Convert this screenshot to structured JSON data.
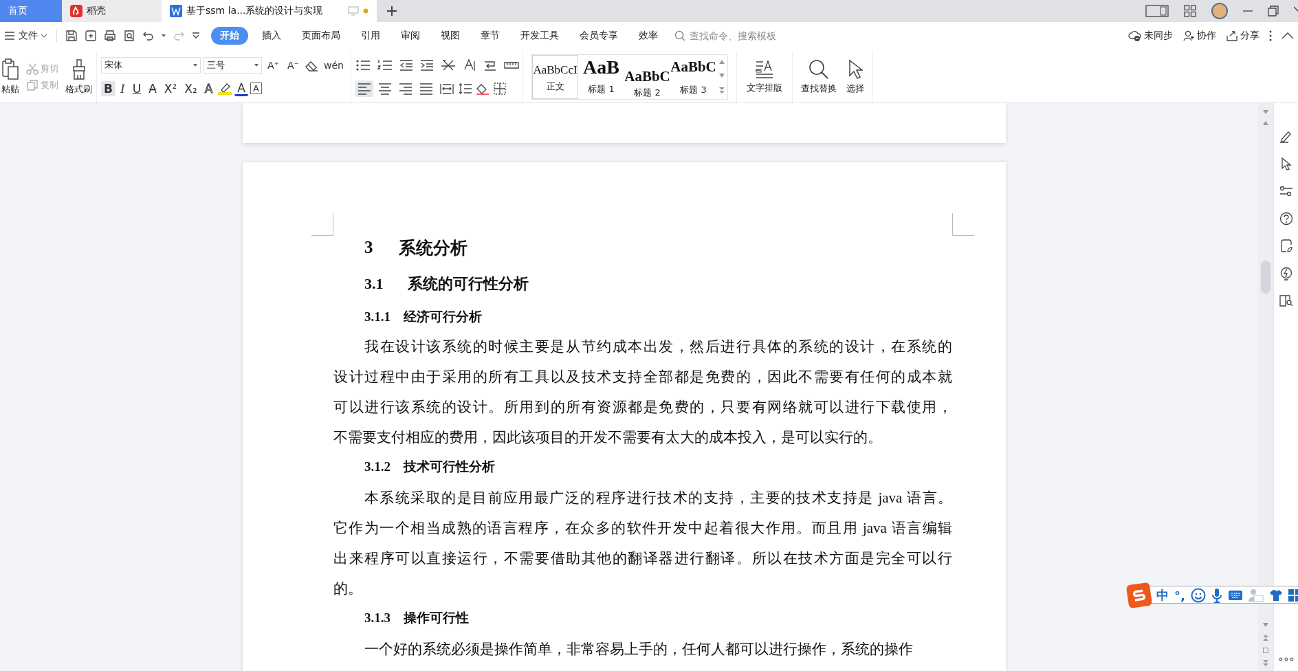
{
  "tabs": [
    {
      "label": "首页",
      "kind": "home",
      "selected": false
    },
    {
      "label": "稻壳",
      "kind": "store",
      "selected": false
    },
    {
      "label": "基于ssm la...系统的设计与实现",
      "kind": "doc",
      "selected": true
    }
  ],
  "menu": {
    "file": "文件",
    "tabs": [
      {
        "label": "开始",
        "selected": true
      },
      {
        "label": "插入",
        "selected": false
      },
      {
        "label": "页面布局",
        "selected": false
      },
      {
        "label": "引用",
        "selected": false
      },
      {
        "label": "审阅",
        "selected": false
      },
      {
        "label": "视图",
        "selected": false
      },
      {
        "label": "章节",
        "selected": false
      },
      {
        "label": "开发工具",
        "selected": false
      },
      {
        "label": "会员专享",
        "selected": false
      },
      {
        "label": "效率",
        "selected": false
      }
    ],
    "search": {
      "placeholder": "查找命令、搜索模板"
    },
    "actions": [
      "未同步",
      "协作",
      "分享"
    ]
  },
  "ribbon": {
    "clipboard": {
      "paste": "粘贴",
      "cut": "剪切",
      "copy": "复制",
      "painter": "格式刷"
    },
    "font": {
      "name": "宋体",
      "size": "三号"
    },
    "font_tools": [
      "A⁺",
      "A⁻",
      "wén"
    ],
    "format_buttons": [
      {
        "label": "B",
        "kind": "bold",
        "selected": true
      },
      {
        "label": "I",
        "kind": "italic",
        "selected": false
      },
      {
        "label": "U",
        "kind": "underline",
        "selected": false
      },
      {
        "label": "A",
        "kind": "strike",
        "selected": false
      },
      {
        "label": "X²",
        "kind": "plain",
        "selected": false
      },
      {
        "label": "X₂",
        "kind": "plain",
        "selected": false
      },
      {
        "label": "A",
        "kind": "outline",
        "selected": false
      }
    ],
    "font_color": "A",
    "char_border": "A",
    "alignment": [
      {
        "kind": "left",
        "selected": true
      },
      {
        "kind": "center",
        "selected": false
      },
      {
        "kind": "right",
        "selected": false
      },
      {
        "kind": "justify",
        "selected": false
      },
      {
        "kind": "distributed",
        "selected": false
      }
    ],
    "styles": [
      {
        "sample": "AaBbCcI",
        "label": "正文",
        "kind": "body",
        "selected": true
      },
      {
        "sample": "AaB",
        "label": "标题 1",
        "kind": "h1",
        "selected": false
      },
      {
        "sample": "AaBbC",
        "label": "标题 2",
        "kind": "h2",
        "selected": false
      },
      {
        "sample": "AaBbC",
        "label": "标题 3",
        "kind": "h3",
        "selected": false
      }
    ],
    "tools": [
      "文字排版",
      "查找替换",
      "选择"
    ]
  },
  "document": {
    "blocks": [
      {
        "kind": "h1",
        "number": "3",
        "title": "系统分析"
      },
      {
        "kind": "h2",
        "number": "3.1",
        "title": "系统的可行性分析"
      },
      {
        "kind": "h3",
        "number": "3.1.1",
        "title": "经济可行分析"
      },
      {
        "kind": "para",
        "lines": [
          "我在设计该系统的时候主要是从节约成本出发，然后进行具体的系统的设计，在系统的",
          "设计过程中由于采用的所有工具以及技术支持全部都是免费的，因此不需要有任何的成本就",
          "可以进行该系统的设计。所用到的所有资源都是免费的，只要有网络就可以进行下载使用，",
          "不需要支付相应的费用，因此该项目的开发不需要有太大的成本投入，是可以实行的。"
        ]
      },
      {
        "kind": "h3",
        "number": "3.1.2",
        "title": "技术可行性分析"
      },
      {
        "kind": "para",
        "lines": [
          "本系统采取的是目前应用最广泛的程序进行技术的支持，主要的技术支持是 java 语言。",
          "它作为一个相当成熟的语言程序，在众多的软件开发中起着很大作用。而且用 java 语言编辑",
          "出来程序可以直接运行，不需要借助其他的翻译器进行翻译。所以在技术方面是完全可以行",
          "的。"
        ]
      },
      {
        "kind": "h3",
        "number": "3.1.3",
        "title": "操作可行性"
      },
      {
        "kind": "para",
        "lines": [
          "一个好的系统必须是操作简单，非常容易上手的，任何人都可以进行操作，系统的操作"
        ]
      }
    ]
  },
  "ime": {
    "mode": "中",
    "punct": "°,"
  }
}
